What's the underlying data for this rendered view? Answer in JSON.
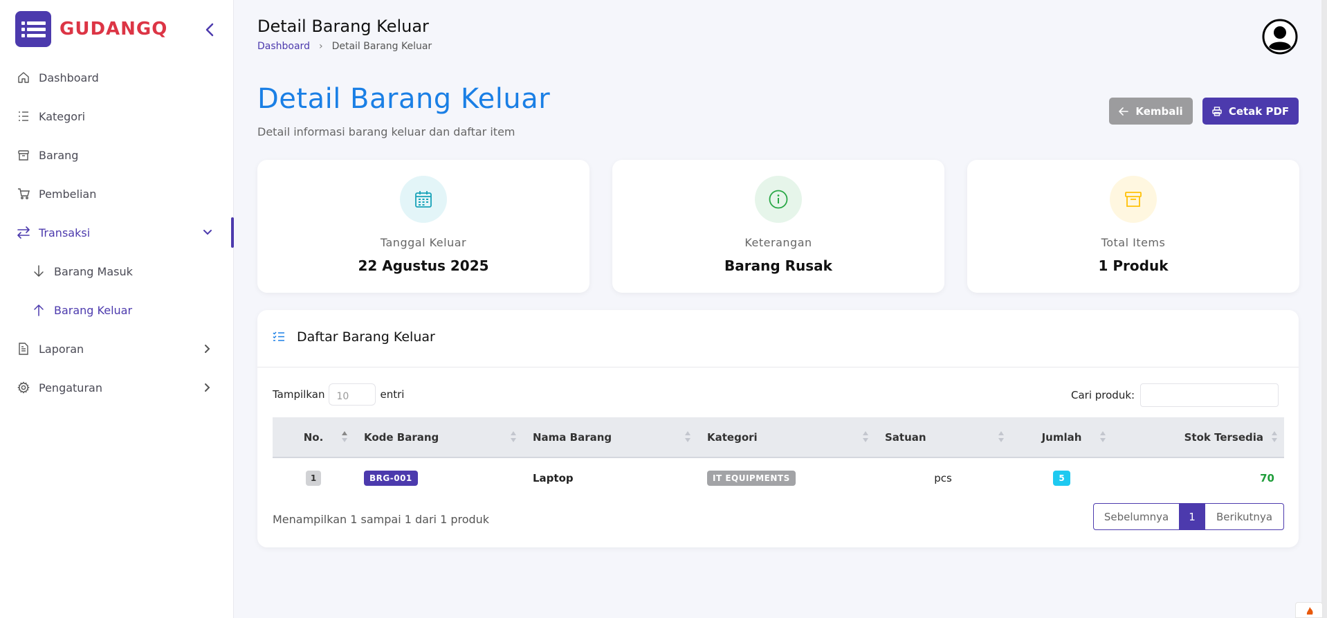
{
  "brand": {
    "name": "GUDANGQ"
  },
  "sidebar": {
    "items": [
      {
        "label": "Dashboard",
        "icon": "home-icon"
      },
      {
        "label": "Kategori",
        "icon": "list-icon"
      },
      {
        "label": "Barang",
        "icon": "box-icon"
      },
      {
        "label": "Pembelian",
        "icon": "cart-icon"
      },
      {
        "label": "Transaksi",
        "icon": "transfer-icon"
      },
      {
        "label": "Barang Masuk",
        "icon": "arrow-down-icon"
      },
      {
        "label": "Barang Keluar",
        "icon": "arrow-up-icon"
      },
      {
        "label": "Laporan",
        "icon": "document-icon"
      },
      {
        "label": "Pengaturan",
        "icon": "gear-icon"
      }
    ]
  },
  "header": {
    "title": "Detail Barang Keluar",
    "breadcrumb": {
      "home": "Dashboard",
      "current": "Detail Barang Keluar"
    }
  },
  "page": {
    "title": "Detail Barang Keluar",
    "subtitle": "Detail informasi barang keluar dan daftar item",
    "back_label": "Kembali",
    "pdf_label": "Cetak PDF"
  },
  "stats": [
    {
      "label": "Tanggal Keluar",
      "value": "22 Agustus 2025",
      "icon": "calendar-icon",
      "color": "#17a2b8"
    },
    {
      "label": "Keterangan",
      "value": "Barang Rusak",
      "icon": "info-icon",
      "color": "#28a745"
    },
    {
      "label": "Total Items",
      "value": "1 Produk",
      "icon": "box-icon",
      "color": "#ffc107"
    }
  ],
  "table": {
    "title": "Daftar Barang Keluar",
    "length_label_before": "Tampilkan",
    "length_value": "10",
    "length_label_after": "entri",
    "search_label": "Cari produk:",
    "columns": [
      "No.",
      "Kode Barang",
      "Nama Barang",
      "Kategori",
      "Satuan",
      "Jumlah",
      "Stok Tersedia"
    ],
    "rows": [
      {
        "no": "1",
        "kode": "BRG-001",
        "nama": "Laptop",
        "kategori": "IT EQUIPMENTS",
        "satuan": "pcs",
        "jumlah": "5",
        "stok": "70"
      }
    ],
    "info": "Menampilkan 1 sampai 1 dari 1 produk",
    "pagination": {
      "prev": "Sebelumnya",
      "current": "1",
      "next": "Berikutnya"
    }
  },
  "colors": {
    "primary": "#4c3aad",
    "title_blue": "#1a7fe5",
    "brand_red": "#dc3545"
  }
}
